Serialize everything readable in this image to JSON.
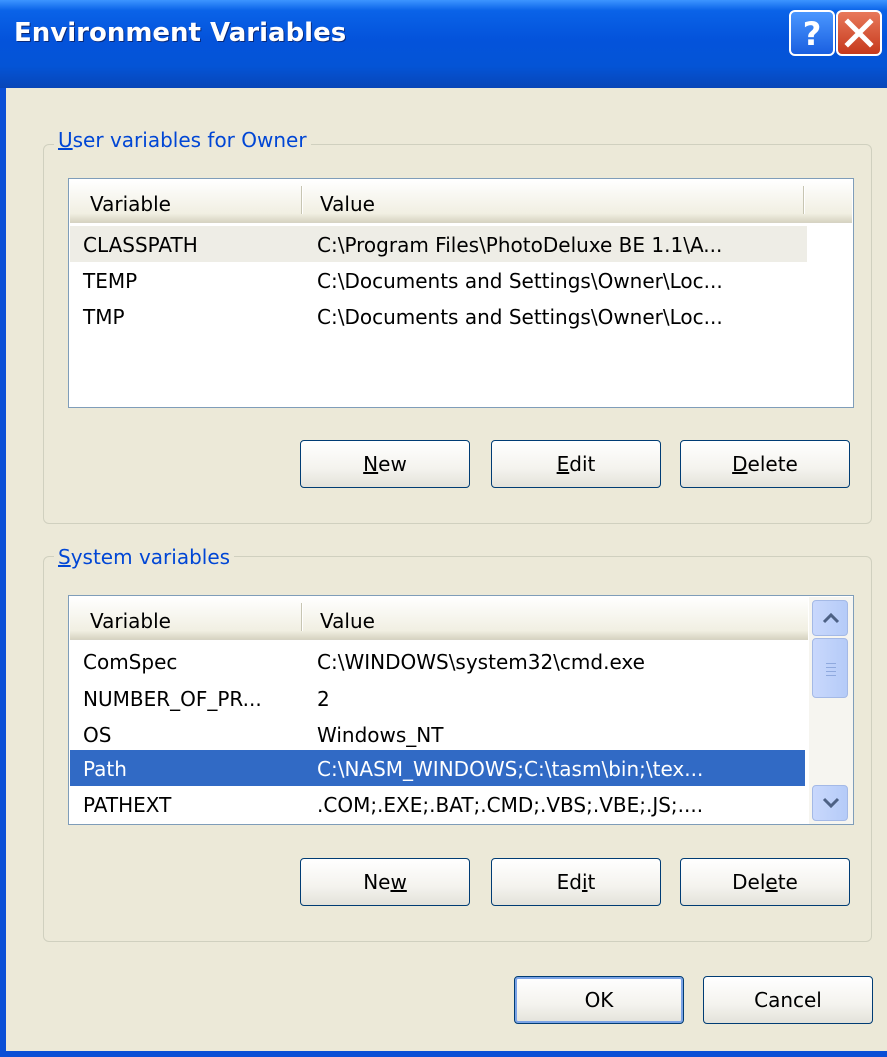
{
  "window": {
    "title": "Environment Variables"
  },
  "user_group": {
    "label_key": "U",
    "label_rest": "ser variables for Owner",
    "columns": [
      "Variable",
      "Value"
    ],
    "rows": [
      {
        "variable": "CLASSPATH",
        "value": "C:\\Program Files\\PhotoDeluxe BE 1.1\\A..."
      },
      {
        "variable": "TEMP",
        "value": "C:\\Documents and Settings\\Owner\\Loc..."
      },
      {
        "variable": "TMP",
        "value": "C:\\Documents and Settings\\Owner\\Loc..."
      }
    ],
    "buttons": {
      "new": {
        "key": "N",
        "rest": "ew"
      },
      "edit": {
        "key": "E",
        "rest": "dit"
      },
      "delete": {
        "key": "D",
        "rest": "elete"
      }
    }
  },
  "system_group": {
    "label_key": "S",
    "label_rest": "ystem variables",
    "columns": [
      "Variable",
      "Value"
    ],
    "rows": [
      {
        "variable": "ComSpec",
        "value": "C:\\WINDOWS\\system32\\cmd.exe"
      },
      {
        "variable": "NUMBER_OF_PR...",
        "value": "2"
      },
      {
        "variable": "OS",
        "value": "Windows_NT"
      },
      {
        "variable": "Path",
        "value": "C:\\NASM_WINDOWS;C:\\tasm\\bin;\\tex..."
      },
      {
        "variable": "PATHEXT",
        "value": ".COM;.EXE;.BAT;.CMD;.VBS;.VBE;.JS;...."
      }
    ],
    "selected_row": "Path",
    "buttons": {
      "new": {
        "pre": "Ne",
        "key": "w",
        "rest": ""
      },
      "edit": {
        "pre": "Ed",
        "key": "i",
        "rest": "t"
      },
      "delete": {
        "pre": "Del",
        "key": "e",
        "rest": "te"
      }
    }
  },
  "footer": {
    "ok": "OK",
    "cancel": "Cancel"
  },
  "colors": {
    "titlebar": "#0453DB",
    "selection": "#316AC5",
    "group_label": "#0046D5",
    "dialog_bg": "#ECE9D8"
  }
}
